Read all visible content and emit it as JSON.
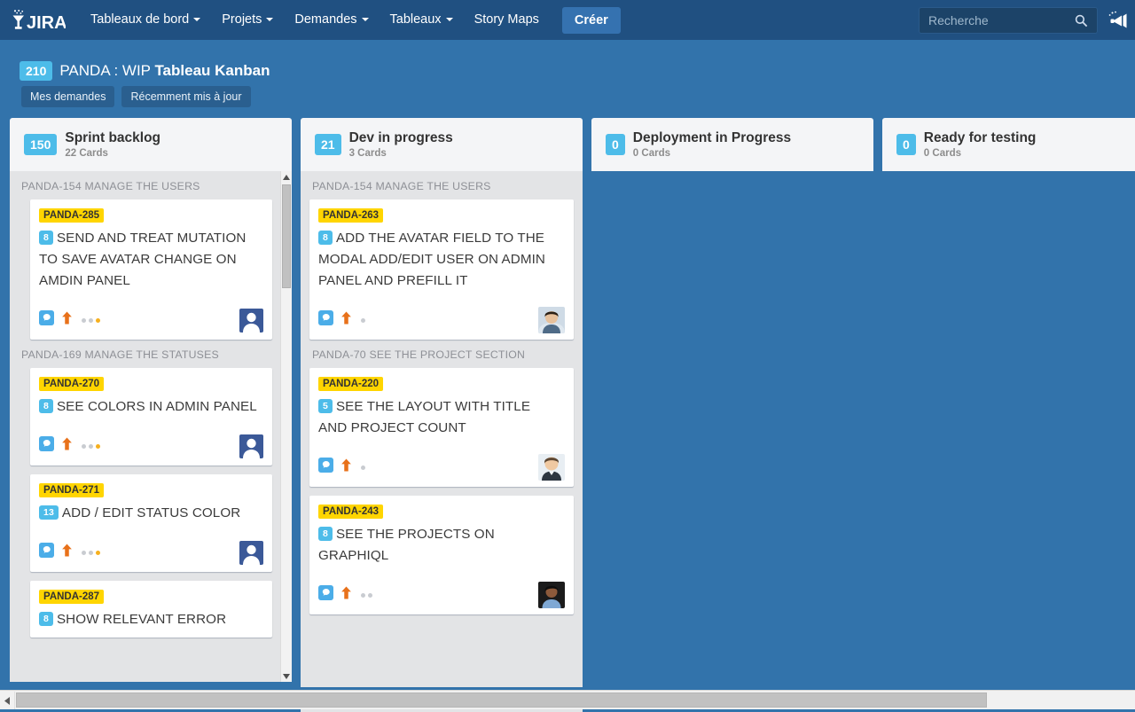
{
  "nav": {
    "logo_text": "JIRA",
    "logo_icon": "jira-logo-icon",
    "items": [
      {
        "label": "Tableaux de bord",
        "has_caret": true
      },
      {
        "label": "Projets",
        "has_caret": true
      },
      {
        "label": "Demandes",
        "has_caret": true
      },
      {
        "label": "Tableaux",
        "has_caret": true
      },
      {
        "label": "Story Maps",
        "has_caret": false
      }
    ],
    "create_label": "Créer",
    "search_placeholder": "Recherche",
    "search_value": "",
    "search_icon": "search-icon",
    "megaphone_icon": "megaphone-icon"
  },
  "board": {
    "epic_count": "210",
    "title_prefix": "PANDA : WIP ",
    "title_bold": "Tableau Kanban",
    "filters": [
      {
        "label": "Mes demandes"
      },
      {
        "label": "Récemment mis à jour"
      }
    ]
  },
  "colors": {
    "nav_bg": "#205081",
    "page_bg": "#3273ab",
    "accent_blue": "#4dbce9",
    "card_key_yellow": "#ffd500",
    "column_bg": "#e3e4e6",
    "column_header_bg": "#f4f5f7",
    "priority_arrow": "#e8711a",
    "avatar_blue": "#3b5998"
  },
  "columns": [
    {
      "wip": "150",
      "name": "Sprint backlog",
      "cards_count": "22 Cards",
      "has_scrollbar": true,
      "swimlanes": [
        {
          "label": "PANDA-154 MANAGE THE USERS",
          "cards": [
            {
              "key": "PANDA-285",
              "points": "8",
              "summary": "SEND AND TREAT MUTATION TO SAVE AVATAR CHANGE ON AMDIN PANEL",
              "type_icon": "story-icon",
              "priority_icon": "priority-high-up-arrow-icon",
              "dots": [
                "gray",
                "gray",
                "yellow"
              ],
              "avatar": "default-person-avatar"
            }
          ]
        },
        {
          "label": "PANDA-169 MANAGE THE STATUSES",
          "cards": [
            {
              "key": "PANDA-270",
              "points": "8",
              "summary": "SEE COLORS IN ADMIN PANEL",
              "type_icon": "story-icon",
              "priority_icon": "priority-high-up-arrow-icon",
              "dots": [
                "gray",
                "gray",
                "yellow"
              ],
              "avatar": "default-person-avatar"
            },
            {
              "key": "PANDA-271",
              "points": "13",
              "summary": "ADD / EDIT STATUS COLOR",
              "type_icon": "story-icon",
              "priority_icon": "priority-high-up-arrow-icon",
              "dots": [
                "gray",
                "gray",
                "yellow"
              ],
              "avatar": "default-person-avatar"
            },
            {
              "key": "PANDA-287",
              "points": "8",
              "summary": "SHOW RELEVANT ERROR",
              "type_icon": "story-icon",
              "priority_icon": "priority-high-up-arrow-icon",
              "dots": [],
              "avatar": "none"
            }
          ]
        }
      ]
    },
    {
      "wip": "21",
      "name": "Dev in progress",
      "cards_count": "3 Cards",
      "has_scrollbar": false,
      "swimlanes": [
        {
          "label": "PANDA-154 MANAGE THE USERS",
          "cards": [
            {
              "key": "PANDA-263",
              "points": "8",
              "summary": "ADD THE AVATAR FIELD TO THE MODAL ADD/EDIT USER ON ADMIN PANEL AND PREFILL IT",
              "type_icon": "story-icon",
              "priority_icon": "priority-high-up-arrow-icon",
              "dots": [
                "gray"
              ],
              "avatar": "photo-avatar-1"
            }
          ]
        },
        {
          "label": "PANDA-70 SEE THE PROJECT SECTION",
          "cards": [
            {
              "key": "PANDA-220",
              "points": "5",
              "summary": "SEE THE LAYOUT WITH TITLE AND PROJECT COUNT",
              "type_icon": "story-icon",
              "priority_icon": "priority-high-up-arrow-icon",
              "dots": [
                "gray"
              ],
              "avatar": "photo-avatar-2"
            },
            {
              "key": "PANDA-243",
              "points": "8",
              "summary": "SEE THE PROJECTS ON GRAPHIQL",
              "type_icon": "story-icon",
              "priority_icon": "priority-high-up-arrow-icon",
              "dots": [
                "gray",
                "gray"
              ],
              "avatar": "photo-avatar-3"
            }
          ]
        }
      ]
    },
    {
      "wip": "0",
      "name": "Deployment in Progress",
      "cards_count": "0 Cards",
      "has_scrollbar": false,
      "swimlanes": []
    },
    {
      "wip": "0",
      "name": "Ready for testing",
      "cards_count": "0 Cards",
      "has_scrollbar": false,
      "swimlanes": []
    }
  ],
  "scrollbars": {
    "horizontal_position_pct": 0,
    "vertical_position_pct": 3
  }
}
